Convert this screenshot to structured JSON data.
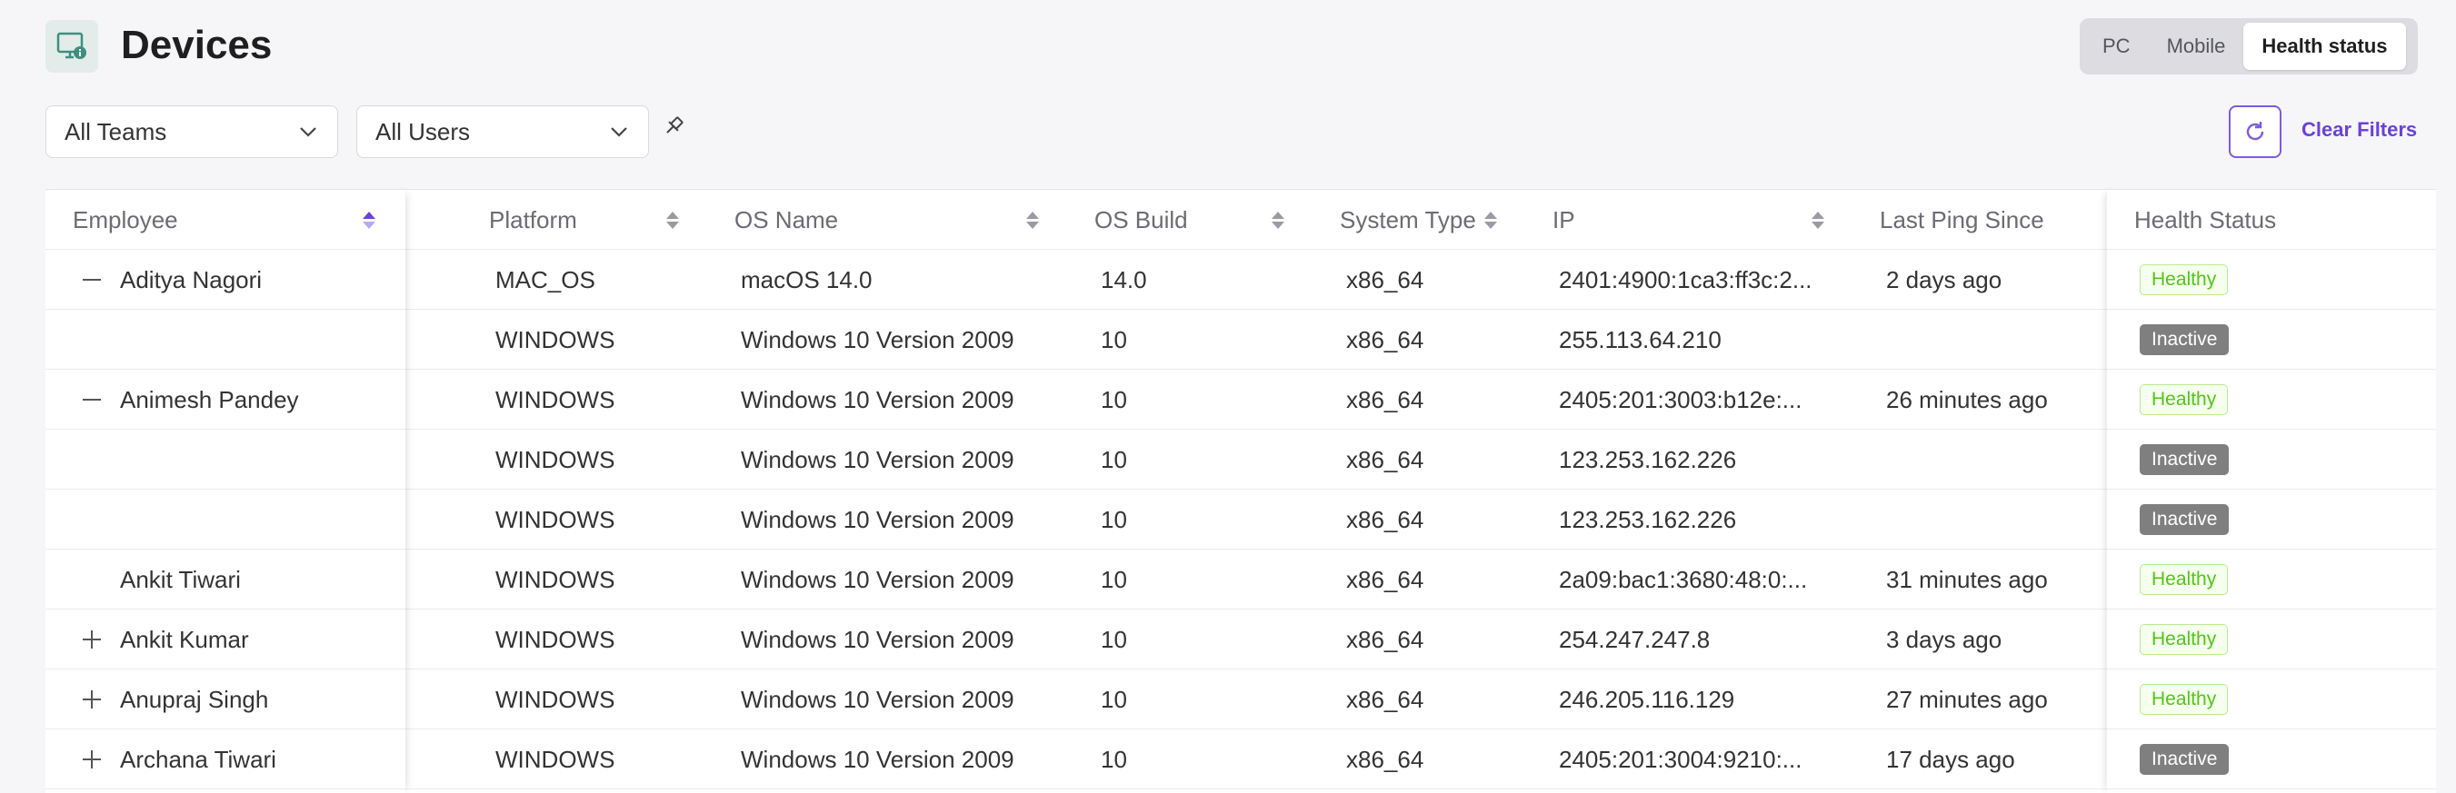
{
  "header": {
    "title": "Devices",
    "app_icon": "devices-monitor-icon",
    "tabs": [
      {
        "label": "PC",
        "active": false
      },
      {
        "label": "Mobile",
        "active": false
      },
      {
        "label": "Health status",
        "active": true
      }
    ]
  },
  "filters": {
    "teams": "All Teams",
    "users": "All Users",
    "pin_icon": "pin-icon",
    "refresh_icon": "refresh-icon",
    "clear_label": "Clear Filters"
  },
  "colors": {
    "accent": "#6a42d8",
    "healthy_text": "#52c41a",
    "healthy_bg": "#f6ffed",
    "inactive_bg": "#7f7f7f"
  },
  "table": {
    "columns": {
      "employee": "Employee",
      "platform": "Platform",
      "os_name": "OS Name",
      "os_build": "OS Build",
      "system_type": "System Type",
      "ip": "IP",
      "last_ping": "Last Ping Since",
      "health": "Health Status"
    },
    "rows": [
      {
        "expander": "minus",
        "employee": "Aditya Nagori",
        "platform": "MAC_OS",
        "os_name": "macOS 14.0",
        "os_build": "14.0",
        "system_type": "x86_64",
        "ip": "2401:4900:1ca3:ff3c:2...",
        "last_ping": "2 days ago",
        "health": "Healthy"
      },
      {
        "expander": "",
        "employee": "",
        "platform": "WINDOWS",
        "os_name": "Windows 10 Version 2009",
        "os_build": "10",
        "system_type": "x86_64",
        "ip": "255.113.64.210",
        "last_ping": "",
        "health": "Inactive"
      },
      {
        "expander": "minus",
        "employee": "Animesh Pandey",
        "platform": "WINDOWS",
        "os_name": "Windows 10 Version 2009",
        "os_build": "10",
        "system_type": "x86_64",
        "ip": "2405:201:3003:b12e:...",
        "last_ping": "26 minutes ago",
        "health": "Healthy"
      },
      {
        "expander": "",
        "employee": "",
        "platform": "WINDOWS",
        "os_name": "Windows 10 Version 2009",
        "os_build": "10",
        "system_type": "x86_64",
        "ip": "123.253.162.226",
        "last_ping": "",
        "health": "Inactive"
      },
      {
        "expander": "",
        "employee": "",
        "platform": "WINDOWS",
        "os_name": "Windows 10 Version 2009",
        "os_build": "10",
        "system_type": "x86_64",
        "ip": "123.253.162.226",
        "last_ping": "",
        "health": "Inactive"
      },
      {
        "expander": "",
        "employee": "Ankit Tiwari",
        "platform": "WINDOWS",
        "os_name": "Windows 10 Version 2009",
        "os_build": "10",
        "system_type": "x86_64",
        "ip": "2a09:bac1:3680:48:0:...",
        "last_ping": "31 minutes ago",
        "health": "Healthy"
      },
      {
        "expander": "plus",
        "employee": "Ankit Kumar",
        "platform": "WINDOWS",
        "os_name": "Windows 10 Version 2009",
        "os_build": "10",
        "system_type": "x86_64",
        "ip": "254.247.247.8",
        "last_ping": "3 days ago",
        "health": "Healthy"
      },
      {
        "expander": "plus",
        "employee": "Anupraj Singh",
        "platform": "WINDOWS",
        "os_name": "Windows 10 Version 2009",
        "os_build": "10",
        "system_type": "x86_64",
        "ip": "246.205.116.129",
        "last_ping": "27 minutes ago",
        "health": "Healthy"
      },
      {
        "expander": "plus",
        "employee": "Archana Tiwari",
        "platform": "WINDOWS",
        "os_name": "Windows 10 Version 2009",
        "os_build": "10",
        "system_type": "x86_64",
        "ip": "2405:201:3004:9210:...",
        "last_ping": "17 days ago",
        "health": "Inactive"
      }
    ]
  }
}
